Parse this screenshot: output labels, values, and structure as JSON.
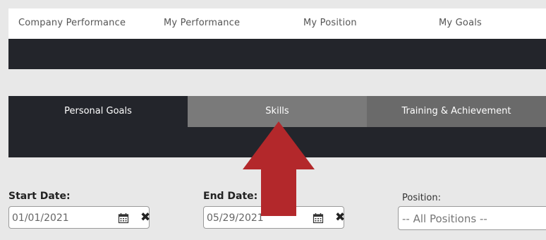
{
  "topnav": {
    "items": [
      "Company Performance",
      "My Performance",
      "My Position",
      "My Goals"
    ]
  },
  "tabs": {
    "items": [
      {
        "label": "Personal Goals",
        "state": "active"
      },
      {
        "label": "Skills",
        "state": "highlighted"
      },
      {
        "label": "Training & Achievement",
        "state": "inactive"
      }
    ]
  },
  "filters": {
    "start_label": "Start Date:",
    "start_value": "01/01/2021",
    "end_label": "End Date:",
    "end_value": "05/29/2021",
    "position_label": "Position:",
    "position_value": "-- All Positions --"
  },
  "icons": {
    "calendar": "calendar-icon",
    "clear": "close-icon",
    "annotation": "up-arrow-annotation"
  },
  "colors": {
    "dark": "#23252b",
    "tab_skills": "#7a7a7a",
    "tab_training": "#6a6a6a",
    "annotation_red": "#b3282b"
  }
}
